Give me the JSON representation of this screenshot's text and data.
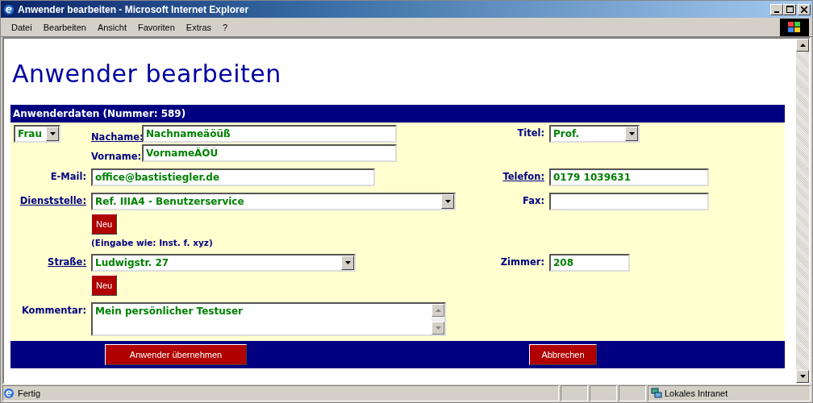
{
  "window": {
    "title": "Anwender bearbeiten - Microsoft Internet Explorer"
  },
  "menu": [
    "Datei",
    "Bearbeiten",
    "Ansicht",
    "Favoriten",
    "Extras",
    "?"
  ],
  "heading": "Anwender bearbeiten",
  "section_title": "Anwenderdaten (Nummer: 589)",
  "salutation": {
    "value": "Frau"
  },
  "lastname": {
    "label": "Nachame:",
    "link": true,
    "value": "Nachnameäöüß"
  },
  "firstname": {
    "label": "Vorname:",
    "link": false,
    "value": "VornameÄÖÜ"
  },
  "title_field": {
    "label": "Titel:",
    "link": false,
    "value": "Prof."
  },
  "email": {
    "label": "E-Mail:",
    "link": false,
    "value": "office@bastistiegler.de"
  },
  "phone": {
    "label": "Telefon:",
    "link": true,
    "value": "0179 1039631"
  },
  "department": {
    "label": "Dienststelle:",
    "link": true,
    "value": "Ref. IIIA4 - Benutzerservice",
    "new_button": "Neu",
    "hint": "(Eingabe wie: Inst. f. xyz)"
  },
  "fax": {
    "label": "Fax:",
    "link": false
  },
  "street": {
    "label": "Straße:",
    "link": true,
    "value": "Ludwigstr. 27",
    "new_button": "Neu"
  },
  "room": {
    "label": "Zimmer:",
    "link": false,
    "value": "208"
  },
  "comment": {
    "label": "Kommentar:",
    "link": false,
    "value": "Mein persönlicher Testuser"
  },
  "buttons": [
    "Anwender übernehmen",
    "Abbrechen"
  ],
  "status_bar": {
    "text": "Fertig",
    "zone": "Lokales Intranet"
  }
}
